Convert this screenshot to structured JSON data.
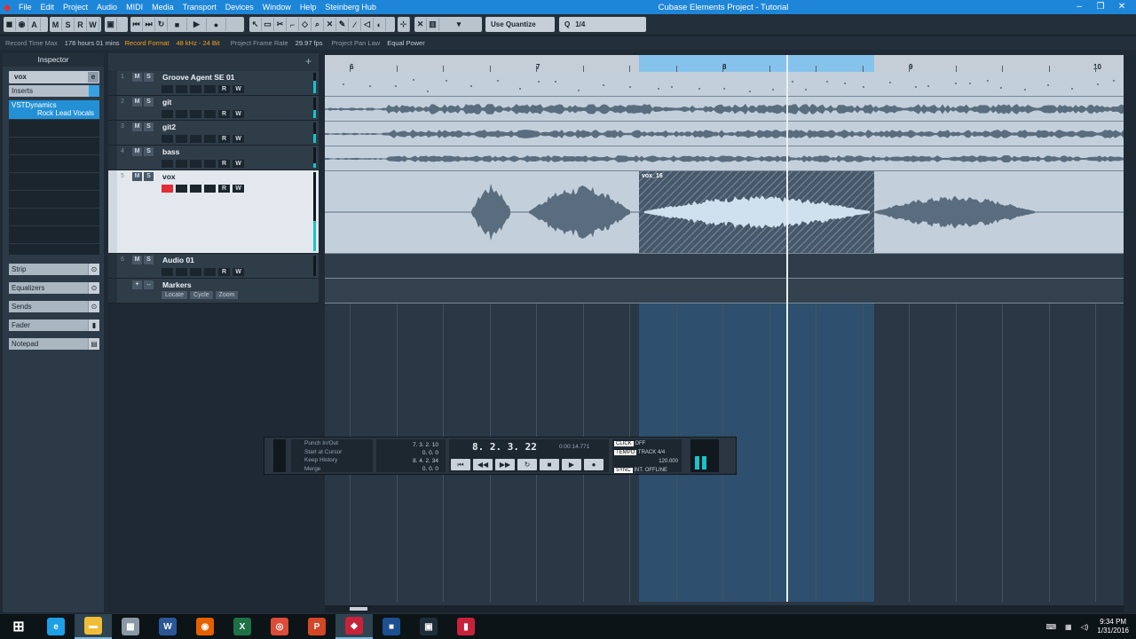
{
  "window": {
    "title": "Cubase Elements Project - Tutorial",
    "menus": [
      "File",
      "Edit",
      "Project",
      "Audio",
      "MIDI",
      "Media",
      "Transport",
      "Devices",
      "Window",
      "Help",
      "Steinberg Hub"
    ],
    "controls": [
      "–",
      "❐",
      "✕"
    ]
  },
  "toolbar": {
    "quantize_label": "Use Quantize",
    "quantize_value": "1/4"
  },
  "statusbar": {
    "record_time_label": "Record Time Max",
    "record_time_value": "178 hours 01 mins",
    "record_format_label": "Record Format",
    "record_format_value": "48 kHz - 24 Bit",
    "frame_rate_label": "Project Frame Rate",
    "frame_rate_value": "29.97 fps",
    "pan_law_label": "Project Pan Law",
    "pan_law_value": "Equal Power"
  },
  "inspector": {
    "title": "Inspector",
    "track_name": "vox",
    "inserts_label": "Inserts",
    "insert_plugin": "VSTDynamics",
    "insert_preset": "Rock Lead Vocals",
    "sections": [
      "Strip",
      "Equalizers",
      "Sends",
      "Fader",
      "Notepad"
    ]
  },
  "tracks": [
    {
      "num": "1",
      "name": "Groove Agent SE 01"
    },
    {
      "num": "2",
      "name": "git"
    },
    {
      "num": "3",
      "name": "git2"
    },
    {
      "num": "4",
      "name": "bass"
    },
    {
      "num": "5",
      "name": "vox"
    },
    {
      "num": "6",
      "name": "Audio 01"
    },
    {
      "num": "",
      "name": "Markers"
    }
  ],
  "markers_buttons": [
    "Locate",
    "Cycle",
    "Zoom"
  ],
  "track_buttons": {
    "mute": "M",
    "solo": "S",
    "read": "R",
    "write": "W"
  },
  "ruler": {
    "bars": [
      "6",
      "7",
      "8",
      "9",
      "10"
    ]
  },
  "event_label": "vox_16",
  "transport": {
    "list": [
      "Punch In/Out",
      "Start at Cursor",
      "Keep History",
      "Merge"
    ],
    "left_locator": "7. 3. 2. 10",
    "left_offset": "0. 0. 0",
    "right_locator": "8. 4. 2. 34",
    "right_offset": "0. 0. 0",
    "position": "8. 2. 3. 22",
    "time": "0:00:14.771",
    "click_label": "CLICK",
    "click_value": "OFF",
    "tempo_label": "TEMPO",
    "tempo_mode": "TRACK",
    "signature": "4/4",
    "tempo": "120.000",
    "sync_label": "SYNC",
    "sync_mode": "INT.",
    "sync_value": "OFFLINE"
  },
  "taskbar": {
    "time": "9:34 PM",
    "date": "1/31/2016",
    "apps": [
      {
        "name": "start",
        "glyph": "⊞",
        "color": "#ffffff"
      },
      {
        "name": "ie",
        "glyph": "e",
        "color": "#1ea0e6"
      },
      {
        "name": "explorer",
        "glyph": "▬",
        "color": "#f2bd36"
      },
      {
        "name": "calculator",
        "glyph": "▦",
        "color": "#8b98a4"
      },
      {
        "name": "word",
        "glyph": "W",
        "color": "#2b5797"
      },
      {
        "name": "firefox",
        "glyph": "◉",
        "color": "#e66000"
      },
      {
        "name": "excel",
        "glyph": "X",
        "color": "#1e7145"
      },
      {
        "name": "chrome",
        "glyph": "◎",
        "color": "#dd4b39"
      },
      {
        "name": "powerpoint",
        "glyph": "P",
        "color": "#d24726"
      },
      {
        "name": "cubase",
        "glyph": "◆",
        "color": "#c8223a"
      },
      {
        "name": "video",
        "glyph": "■",
        "color": "#1d4f91"
      },
      {
        "name": "camtasia",
        "glyph": "▣",
        "color": "#1f2d38"
      },
      {
        "name": "meter",
        "glyph": "▮",
        "color": "#c8223a"
      }
    ]
  },
  "colors": {
    "titlebar": "#1e86d8",
    "waveform": "#5a6d7f",
    "cycle_range": "#86c3ec",
    "record": "#e02d36",
    "insert_active": "#2390d6"
  }
}
